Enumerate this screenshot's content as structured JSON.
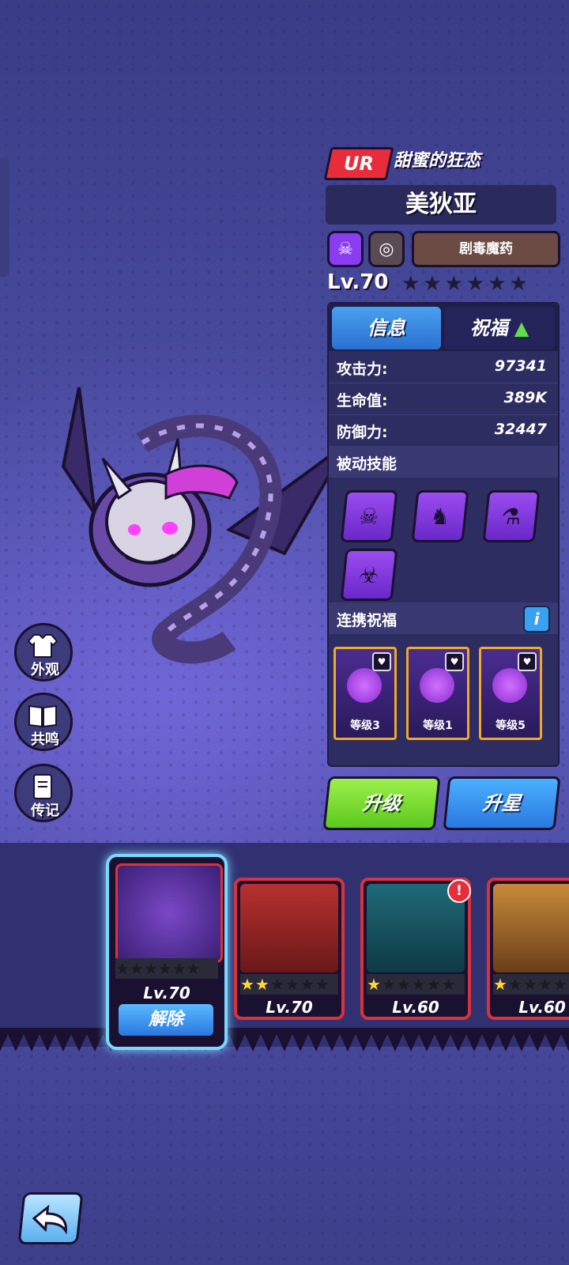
{
  "header": {
    "rarity": "UR",
    "subtitle": "甜蜜的狂恋",
    "name": "美狄亚",
    "faction": "剧毒魔药",
    "level": "Lv.70",
    "stars": "★★★★★★"
  },
  "tabs": {
    "info": "信息",
    "bless": "祝福",
    "bless_up": "▲"
  },
  "stats": [
    {
      "label": "攻击力:",
      "value": "97341"
    },
    {
      "label": "生命值:",
      "value": "389K"
    },
    {
      "label": "防御力:",
      "value": "32447"
    }
  ],
  "passive": {
    "title": "被动技能",
    "icons": [
      "poison-card-icon",
      "ghost-icon",
      "potion-icon",
      "wolf-icon"
    ],
    "glyphs": [
      "☠",
      "♞",
      "⚗",
      "☣"
    ]
  },
  "bonds": {
    "title": "连携祝福",
    "info": "i",
    "items": [
      {
        "label": "等级3"
      },
      {
        "label": "等级1"
      },
      {
        "label": "等级5"
      }
    ]
  },
  "buttons": {
    "upgrade": "升级",
    "star_up": "升星"
  },
  "side": {
    "appearance": "外观",
    "resonance": "共鸣",
    "biography": "传记"
  },
  "roster": {
    "selected": {
      "level": "Lv.70",
      "release": "解除",
      "stars": "★★★★★★"
    },
    "cards": [
      {
        "level": "Lv.70",
        "stars_lit": "★★",
        "stars_dim": "★★★★"
      },
      {
        "level": "Lv.60",
        "stars_lit": "★",
        "stars_dim": "★★★★★"
      },
      {
        "level": "Lv.60",
        "stars_lit": "★",
        "stars_dim": "★★★★★"
      }
    ],
    "alert": "!"
  },
  "colors": {
    "accent_green": "#5cc81e",
    "accent_blue": "#2a78e0",
    "rarity_red": "#e82c3c",
    "card_border": "#d8323c"
  }
}
